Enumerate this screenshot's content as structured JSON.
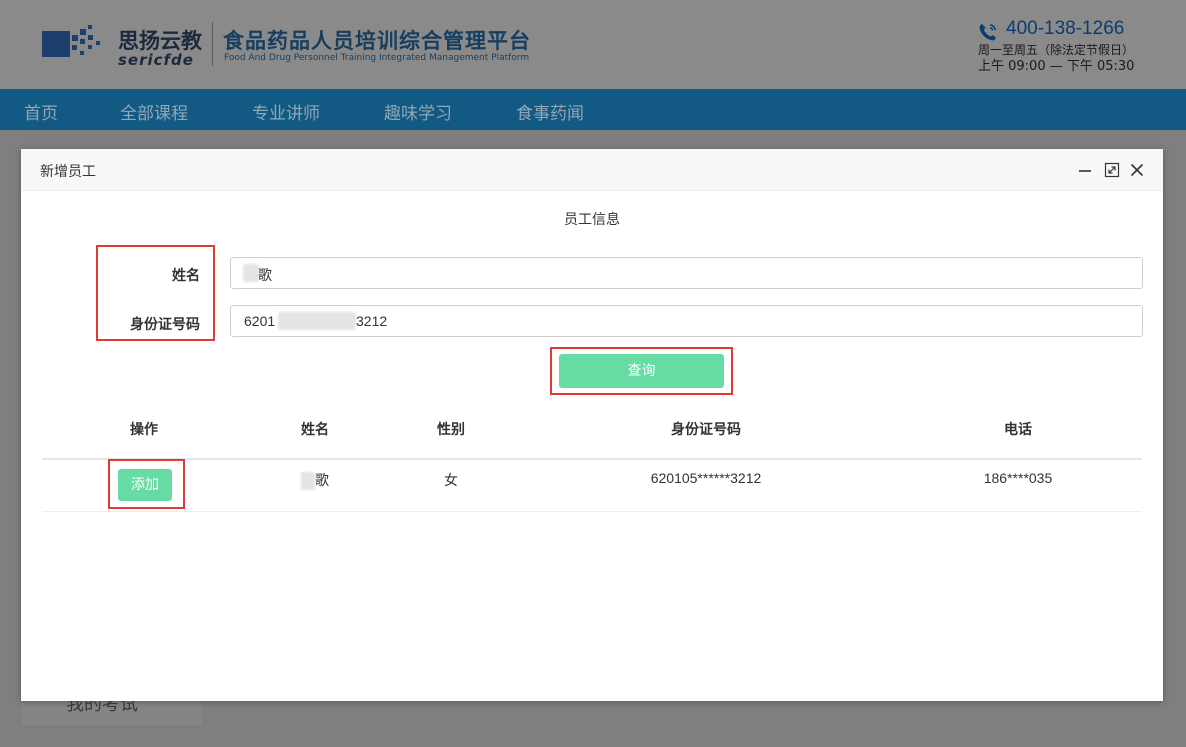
{
  "site": {
    "logo_cn": "思扬云教",
    "logo_en": "sericfde",
    "platform_cn": "食品药品人员培训综合管理平台",
    "platform_en": "Food And Drug Personnel Training Integrated Management Platform",
    "phone": "400-138-1266",
    "hours_line1": "周一至周五（除法定节假日）",
    "hours_line2": "上午 09:00 — 下午 05:30"
  },
  "nav": {
    "items": [
      {
        "label": "首页"
      },
      {
        "label": "全部课程"
      },
      {
        "label": "专业讲师"
      },
      {
        "label": "趣味学习"
      },
      {
        "label": "食事药闻"
      }
    ]
  },
  "side": {
    "partial_text": "我的考试"
  },
  "modal": {
    "title": "新增员工",
    "section_title": "员工信息",
    "form": {
      "name_label": "姓名",
      "name_value": "歌",
      "id_label": "身份证号码",
      "id_value_prefix": "6201",
      "id_value_suffix": "3212"
    },
    "query_button": "查询",
    "table": {
      "headers": [
        "操作",
        "姓名",
        "性别",
        "身份证号码",
        "电话"
      ],
      "rows": [
        {
          "action": "添加",
          "name": "歌",
          "gender": "女",
          "id_number": "620105******3212",
          "phone": "186****035"
        }
      ]
    }
  },
  "colors": {
    "nav_bg": "#125a83",
    "accent_green": "#66dba3",
    "highlight_red": "#e53935",
    "overlay": "#7f7f7f"
  },
  "icons": [
    "phone-icon",
    "minimize-icon",
    "maximize-icon",
    "close-icon"
  ]
}
